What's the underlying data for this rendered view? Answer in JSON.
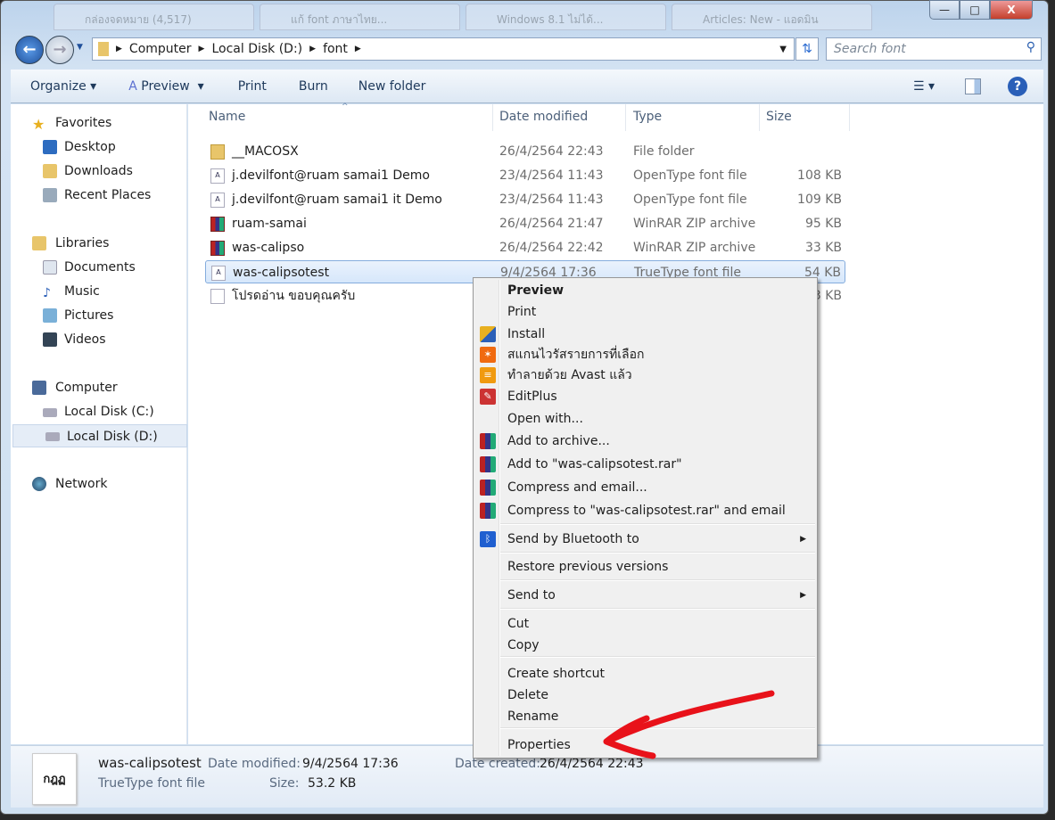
{
  "window": {
    "controls": {
      "minimize": "—",
      "maximize": "□",
      "close": "X"
    }
  },
  "browser_tabs": [
    "กล่องจดหมาย (4,517)",
    "แก้ font ภาษาไทย...",
    "Windows 8.1 ไม่ได้...",
    "Articles: New - แอดมิน"
  ],
  "address": {
    "breadcrumb": [
      "Computer",
      "Local Disk (D:)",
      "font"
    ],
    "search_placeholder": "Search font"
  },
  "toolbar": {
    "organize": "Organize",
    "preview": "Preview",
    "print": "Print",
    "burn": "Burn",
    "new_folder": "New folder"
  },
  "sidebar": {
    "favorites": "Favorites",
    "fav_items": [
      "Desktop",
      "Downloads",
      "Recent Places"
    ],
    "libraries": "Libraries",
    "lib_items": [
      "Documents",
      "Music",
      "Pictures",
      "Videos"
    ],
    "computer": "Computer",
    "drives": [
      "Local Disk (C:)",
      "Local Disk (D:)"
    ],
    "network": "Network"
  },
  "columns": {
    "name": "Name",
    "date": "Date modified",
    "type": "Type",
    "size": "Size"
  },
  "files": [
    {
      "name": "__MACOSX",
      "date": "26/4/2564 22:43",
      "type": "File folder",
      "size": "",
      "icon": "folder"
    },
    {
      "name": "j.devilfont@ruam samai1 Demo",
      "date": "23/4/2564 11:43",
      "type": "OpenType font file",
      "size": "108 KB",
      "icon": "font"
    },
    {
      "name": "j.devilfont@ruam samai1 it Demo",
      "date": "23/4/2564 11:43",
      "type": "OpenType font file",
      "size": "109 KB",
      "icon": "font"
    },
    {
      "name": "ruam-samai",
      "date": "26/4/2564 21:47",
      "type": "WinRAR ZIP archive",
      "size": "95 KB",
      "icon": "rar"
    },
    {
      "name": "was-calipso",
      "date": "26/4/2564 22:42",
      "type": "WinRAR ZIP archive",
      "size": "33 KB",
      "icon": "rar"
    },
    {
      "name": "was-calipsotest",
      "date": "9/4/2564 17:36",
      "type": "TrueType font file",
      "size": "54 KB",
      "icon": "font"
    },
    {
      "name": "โปรดอ่าน ขอบคุณครับ",
      "date": "",
      "type": "",
      "size": "3 KB",
      "icon": "text"
    }
  ],
  "context_menu": [
    "Preview",
    "Print",
    "Install",
    "สแกนไวรัสรายการที่เลือก",
    "ทำลายด้วย Avast แล้ว",
    "EditPlus",
    "Open with...",
    "Add to archive...",
    "Add to \"was-calipsotest.rar\"",
    "Compress and email...",
    "Compress to \"was-calipsotest.rar\" and email",
    "Send by Bluetooth to",
    "Restore previous versions",
    "Send to",
    "Cut",
    "Copy",
    "Create shortcut",
    "Delete",
    "Rename",
    "Properties"
  ],
  "details": {
    "name": "was-calipsotest",
    "type": "TrueType font file",
    "modified_label": "Date modified:",
    "modified": "9/4/2564 17:36",
    "created_label": "Date created:",
    "created": "26/4/2564 22:43",
    "size_label": "Size:",
    "size": "53.2 KB",
    "thumb": "กฎฏ"
  },
  "annotation_color": "#e8121a"
}
